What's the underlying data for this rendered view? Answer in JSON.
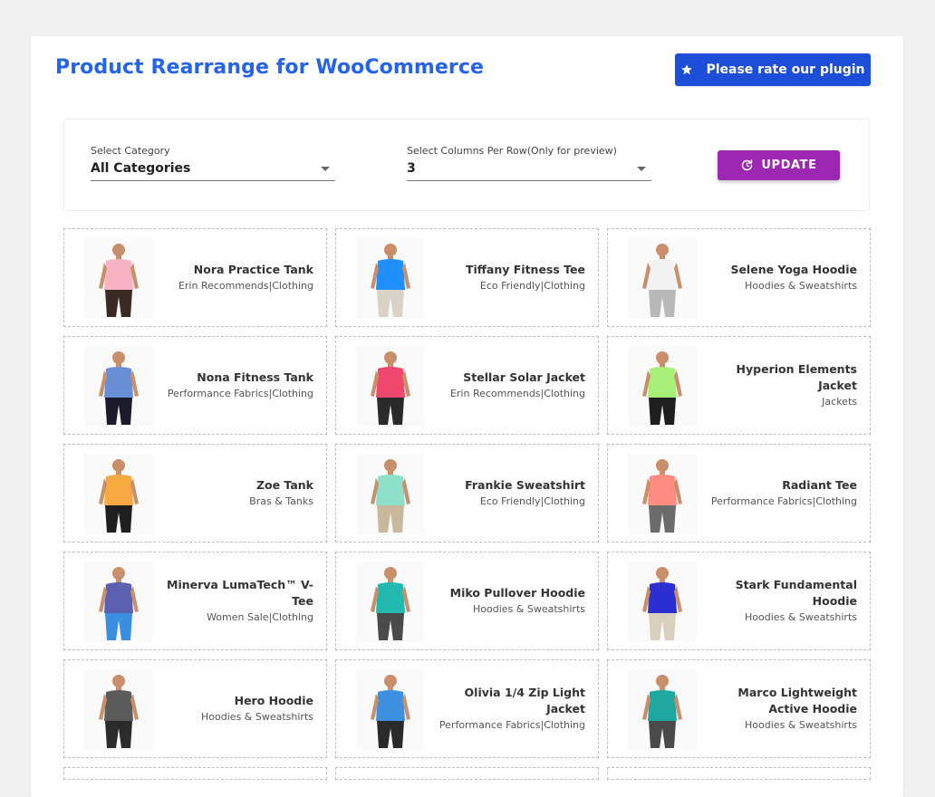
{
  "header": {
    "title": "Product Rearrange for WooCommerce",
    "rate_label": "Please rate our plugin"
  },
  "filters": {
    "category_label": "Select Category",
    "category_value": "All Categories",
    "columns_label": "Select Columns Per Row(Only for preview)",
    "columns_value": "3",
    "update_label": "UPDATE"
  },
  "colors": {
    "title": "#2563eb",
    "rate_button": "#1d4ed8",
    "update_button": "#9c27b0"
  },
  "products": [
    {
      "name": "Nora Practice Tank",
      "category": "Erin Recommends|Clothing",
      "top": "#f8b4c4",
      "bottom": "#3b2a24"
    },
    {
      "name": "Tiffany Fitness Tee",
      "category": "Eco Friendly|Clothing",
      "top": "#1e90ff",
      "bottom": "#d9d2c5"
    },
    {
      "name": "Selene Yoga Hoodie",
      "category": "Hoodies & Sweatshirts",
      "top": "#f3f3f3",
      "bottom": "#b9b9b9"
    },
    {
      "name": "Nona Fitness Tank",
      "category": "Performance Fabrics|Clothing",
      "top": "#6b8fd6",
      "bottom": "#1b1b2b"
    },
    {
      "name": "Stellar Solar Jacket",
      "category": "Erin Recommends|Clothing",
      "top": "#f0476e",
      "bottom": "#2a2a2a"
    },
    {
      "name": "Hyperion Elements Jacket",
      "category": "Jackets",
      "top": "#a8f07a",
      "bottom": "#1f1f1f"
    },
    {
      "name": "Zoe Tank",
      "category": "Bras & Tanks",
      "top": "#f6a940",
      "bottom": "#1f1f1f"
    },
    {
      "name": "Frankie Sweatshirt",
      "category": "Eco Friendly|Clothing",
      "top": "#8fe0c8",
      "bottom": "#c9b99c"
    },
    {
      "name": "Radiant Tee",
      "category": "Performance Fabrics|Clothing",
      "top": "#ff8c82",
      "bottom": "#6b6b6b"
    },
    {
      "name": "Minerva LumaTech™ V-Tee",
      "category": "Women Sale|Clothing",
      "top": "#5a5fb0",
      "bottom": "#3b8fe0"
    },
    {
      "name": "Miko Pullover Hoodie",
      "category": "Hoodies & Sweatshirts",
      "top": "#23b8b0",
      "bottom": "#4a4a4a"
    },
    {
      "name": "Stark Fundamental Hoodie",
      "category": "Hoodies & Sweatshirts",
      "top": "#2b2fd0",
      "bottom": "#d8d0bc"
    },
    {
      "name": "Hero Hoodie",
      "category": "Hoodies & Sweatshirts",
      "top": "#5b5b5b",
      "bottom": "#2b2b2b"
    },
    {
      "name": "Olivia 1/4 Zip Light Jacket",
      "category": "Performance Fabrics|Clothing",
      "top": "#3d8fe0",
      "bottom": "#2a2a2a"
    },
    {
      "name": "Marco Lightweight Active Hoodie",
      "category": "Hoodies & Sweatshirts",
      "top": "#20a8a0",
      "bottom": "#4a4a4a"
    }
  ]
}
